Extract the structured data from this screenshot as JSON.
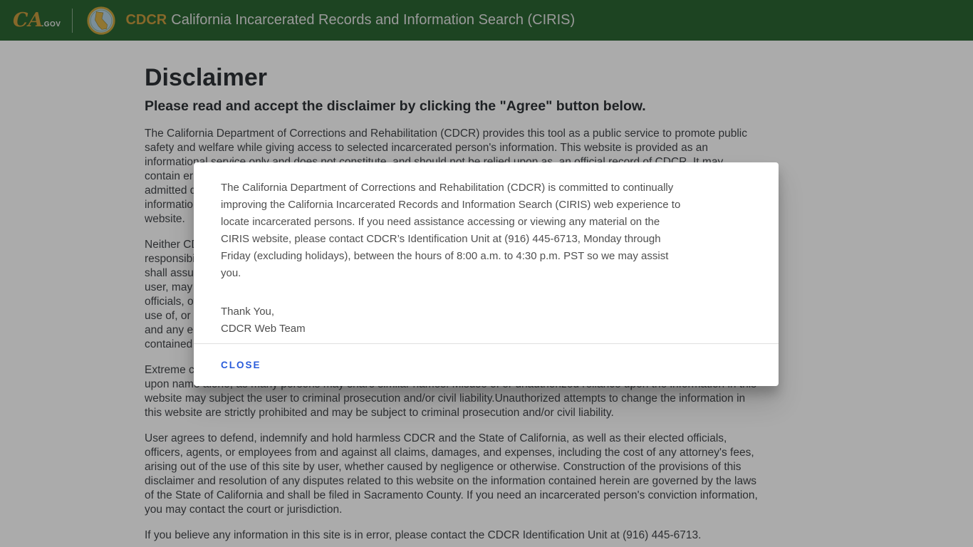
{
  "colors": {
    "header-green": "#2c6633",
    "brand-gold": "#c99b3f",
    "close-blue": "#2a5cdb",
    "body-text": "#43474b",
    "modal-text": "#4f4f4f"
  },
  "header": {
    "ca_logo": {
      "ca": "CA",
      "gov": ".GOV"
    },
    "brand": "CDCR",
    "title": "California Incarcerated Records and Information Search (CIRIS)"
  },
  "page": {
    "heading": "Disclaimer",
    "subheading": "Please read and accept the disclaimer by clicking the \"Agree\" button below.",
    "paragraph1": [
      "The California Department of Corrections and Rehabilitation (CDCR) provides this tool as a public service to promote public",
      "safety and welfare while giving access to selected incarcerated person's information. This website is provided as an",
      "informational service only and does not constitute, and should not be relied upon as, an official record of CDCR. It may",
      "contain errors. Information found on this website includes the incarcerated person's name, age, and commitment county,",
      "admitted date, current location, and Board of Parole Hearings information. CDCR makes no guarantee that the",
      "information is accurate or complete. Victim information is confidential and is never included in the information in this",
      "website."
    ],
    "paragraph2": [
      "Neither CDCR nor the State of California guarantees the accuracy of the records, and neither shall assume any",
      "responsibility for any errors or omissions in the information contained in this website or the use thereof by the user",
      "shall assume all responsibility and all risk of loss from the use of this website. No officer, employee, or agent of the",
      "user, may rely upon the information as an official record of CDCR. Neither CDCR, the State of California, nor their elected",
      "officials, officers, agents, or employees shall be liable for any direct or indirect damages of any kind arising out of the",
      "use of, or the inability to use, this website or the information it contains. The user releases CDCR, the State of California,",
      "and any elected officials, officers, agents, or employees thereof, from liability for the accuracy of the information",
      "contained in this website."
    ],
    "paragraph3": [
      "Extreme care should be taken in using this information to identify a person. Identification cannot be made by relying solely",
      "upon name alone, as many persons may share similar names. Misuse of or unauthorized reliance upon the information in this",
      "website may subject the user to criminal prosecution and/or civil liability.Unauthorized attempts to change the information in",
      "this website are strictly prohibited and may be subject to criminal prosecution and/or civil liability."
    ],
    "paragraph4": [
      "User agrees to defend, indemnify and hold harmless CDCR and the State of California, as well as their elected officials,",
      "officers, agents, or employees from and against all claims, damages, and expenses, including the cost of any attorney's fees,",
      "arising out of the use of this site by user, whether caused by negligence or otherwise. Construction of the provisions of this",
      "disclaimer and resolution of any disputes related to this website on the information contained herein are governed by the laws",
      "of the State of California and shall be filed in Sacramento County. If you need an incarcerated person's conviction information,",
      "you may contact the court or jurisdiction."
    ],
    "paragraph5": [
      "If you believe any information in this site is in error, please contact the CDCR Identification Unit at (916) 445-6713."
    ]
  },
  "modal": {
    "message": [
      "The California Department of Corrections and Rehabilitation (CDCR) is committed to continually",
      "improving the California Incarcerated Records and Information Search (CIRIS) web experience to",
      "locate incarcerated persons. If you need assistance accessing or viewing any material on the",
      "CIRIS website, please contact CDCR’s Identification Unit at (916) 445-6713, Monday through",
      "Friday (excluding holidays), between the hours of 8:00 a.m. to 4:30 p.m. PST so we may assist",
      "you."
    ],
    "signoff": [
      "Thank You,",
      "CDCR Web Team"
    ],
    "close_label": "CLOSE"
  }
}
